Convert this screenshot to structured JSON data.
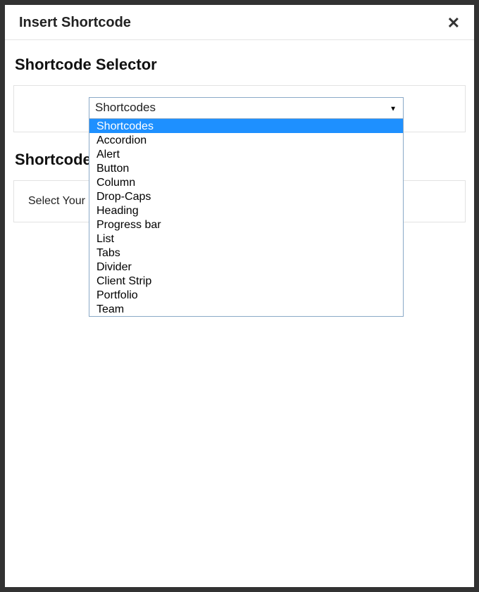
{
  "header": {
    "title": "Insert Shortcode",
    "close_symbol": "✕"
  },
  "sections": {
    "selector_title": "Shortcode Selector",
    "options_title": "Shortcode Options"
  },
  "select": {
    "current": "Shortcodes",
    "caret": "▼",
    "options": [
      "Shortcodes",
      "Accordion",
      "Alert",
      "Button",
      "Column",
      "Drop-Caps",
      "Heading",
      "Progress bar",
      "List",
      "Tabs",
      "Divider",
      "Client Strip",
      "Portfolio",
      "Team"
    ]
  },
  "options_panel": {
    "placeholder_text": "Select Your Shortcode"
  }
}
